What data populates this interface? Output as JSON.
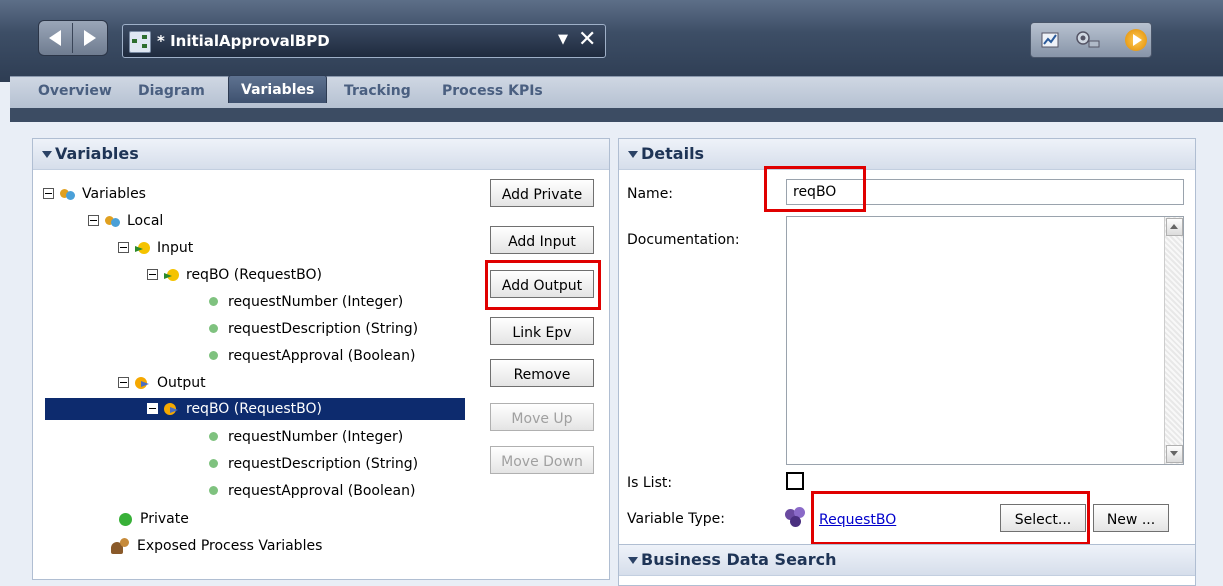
{
  "window": {
    "doc_title": "* InitialApprovalBPD",
    "dropdown_glyph": "▼",
    "close_glyph": "✕"
  },
  "tabs": [
    {
      "label": "Overview"
    },
    {
      "label": "Diagram"
    },
    {
      "label": "Variables",
      "active": true
    },
    {
      "label": "Tracking"
    },
    {
      "label": "Process KPIs"
    }
  ],
  "variables_panel": {
    "title": "Variables",
    "tree": [
      {
        "label": "Variables"
      },
      {
        "label": "Local"
      },
      {
        "label": "Input"
      },
      {
        "label": "reqBO (RequestBO)"
      },
      {
        "label": "requestNumber (Integer)"
      },
      {
        "label": "requestDescription (String)"
      },
      {
        "label": "requestApproval (Boolean)"
      },
      {
        "label": "Output"
      },
      {
        "label": "reqBO (RequestBO)",
        "selected": true
      },
      {
        "label": "requestNumber (Integer)"
      },
      {
        "label": "requestDescription (String)"
      },
      {
        "label": "requestApproval (Boolean)"
      },
      {
        "label": "Private"
      },
      {
        "label": "Exposed Process Variables"
      }
    ],
    "buttons": {
      "add_private": "Add Private",
      "add_input": "Add Input",
      "add_output": "Add Output",
      "link_epv": "Link Epv",
      "remove": "Remove",
      "move_up": "Move Up",
      "move_down": "Move Down"
    }
  },
  "details_panel": {
    "title": "Details",
    "name_label": "Name:",
    "name_value": "reqBO",
    "documentation_label": "Documentation:",
    "documentation_value": "",
    "is_list_label": "Is List:",
    "is_list_checked": false,
    "variable_type_label": "Variable Type:",
    "variable_type_value": "RequestBO",
    "select_button": "Select...",
    "new_button": "New ..."
  },
  "business_search_panel": {
    "title": "Business Data Search"
  },
  "colors": {
    "highlight": "#e00000",
    "selection": "#0d2b6e",
    "link": "#0000cc"
  }
}
